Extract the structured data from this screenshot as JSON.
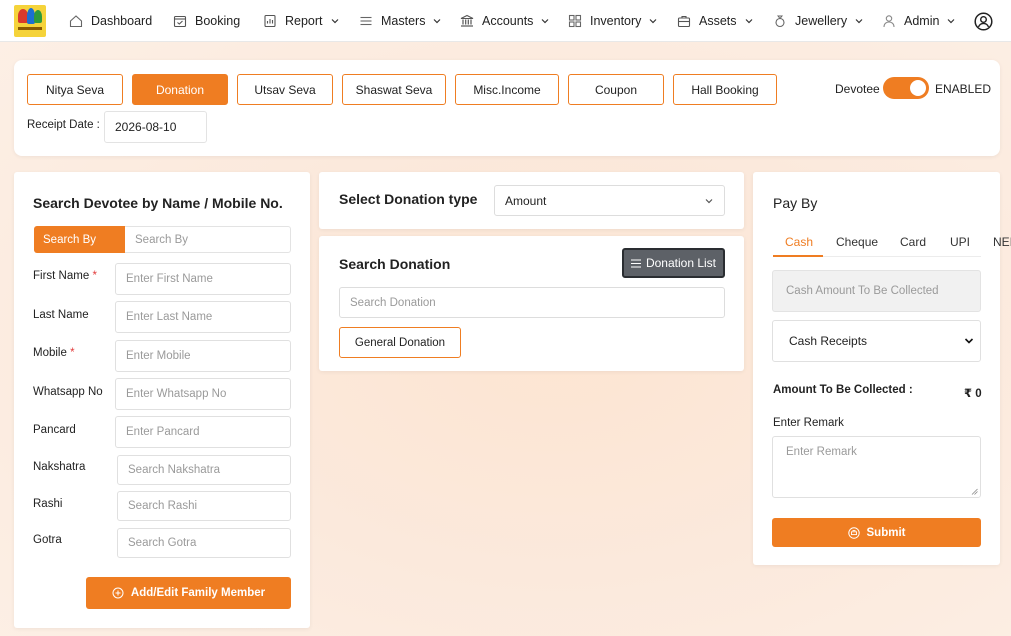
{
  "nav": {
    "items": [
      {
        "label": "Dashboard",
        "icon": "home-icon"
      },
      {
        "label": "Booking",
        "icon": "calendar-check-icon"
      },
      {
        "label": "Report",
        "icon": "report-icon"
      },
      {
        "label": "Masters",
        "icon": "list-icon"
      },
      {
        "label": "Accounts",
        "icon": "bank-icon"
      },
      {
        "label": "Inventory",
        "icon": "inventory-icon"
      },
      {
        "label": "Assets",
        "icon": "briefcase-icon"
      },
      {
        "label": "Jewellery",
        "icon": "ring-icon"
      },
      {
        "label": "Admin",
        "icon": "user-icon"
      }
    ]
  },
  "seva_tabs": [
    {
      "label": "Nitya Seva",
      "active": false
    },
    {
      "label": "Donation",
      "active": true
    },
    {
      "label": "Utsav Seva",
      "active": false
    },
    {
      "label": "Shaswat Seva",
      "active": false
    },
    {
      "label": "Misc.Income",
      "active": false
    },
    {
      "label": "Coupon",
      "active": false
    },
    {
      "label": "Hall Booking",
      "active": false
    }
  ],
  "devotee_toggle": {
    "label": "Devotee",
    "state": "ENABLED",
    "on": true
  },
  "receipt": {
    "label": "Receipt Date :",
    "value": "2026-08-10"
  },
  "search_devotee": {
    "title": "Search Devotee by Name / Mobile No.",
    "search_by_tab": "Search By",
    "search_by_placeholder": "Search By",
    "fields": [
      {
        "label": "First Name",
        "required": true,
        "placeholder": "Enter First Name"
      },
      {
        "label": "Last Name",
        "required": false,
        "placeholder": "Enter Last Name"
      },
      {
        "label": "Mobile",
        "required": true,
        "placeholder": "Enter Mobile"
      },
      {
        "label": "Whatsapp No",
        "required": false,
        "placeholder": "Enter Whatsapp No"
      },
      {
        "label": "Pancard",
        "required": false,
        "placeholder": "Enter Pancard"
      },
      {
        "label": "Nakshatra",
        "required": false,
        "placeholder": "Search Nakshatra"
      },
      {
        "label": "Rashi",
        "required": false,
        "placeholder": "Search Rashi"
      },
      {
        "label": "Gotra",
        "required": false,
        "placeholder": "Search Gotra"
      }
    ],
    "family_button": "Add/Edit Family Member"
  },
  "donation_type": {
    "label": "Select Donation type",
    "selected": "Amount"
  },
  "search_donation": {
    "title": "Search Donation",
    "list_button": "Donation List",
    "placeholder": "Search Donation",
    "items": [
      "General Donation"
    ]
  },
  "pay_by": {
    "title": "Pay By",
    "tabs": [
      "Cash",
      "Cheque",
      "Card",
      "UPI",
      "NEI"
    ],
    "active_tab": "Cash",
    "cash_amount_placeholder": "Cash Amount To Be Collected",
    "receipt_select": "Cash Receipts",
    "amount_label": "Amount To Be Collected :",
    "amount_value": "₹ 0",
    "remark_label": "Enter Remark",
    "remark_placeholder": "Enter Remark",
    "submit": "Submit"
  },
  "colors": {
    "accent": "#ef7d22",
    "dark_button": "#5d6167"
  }
}
